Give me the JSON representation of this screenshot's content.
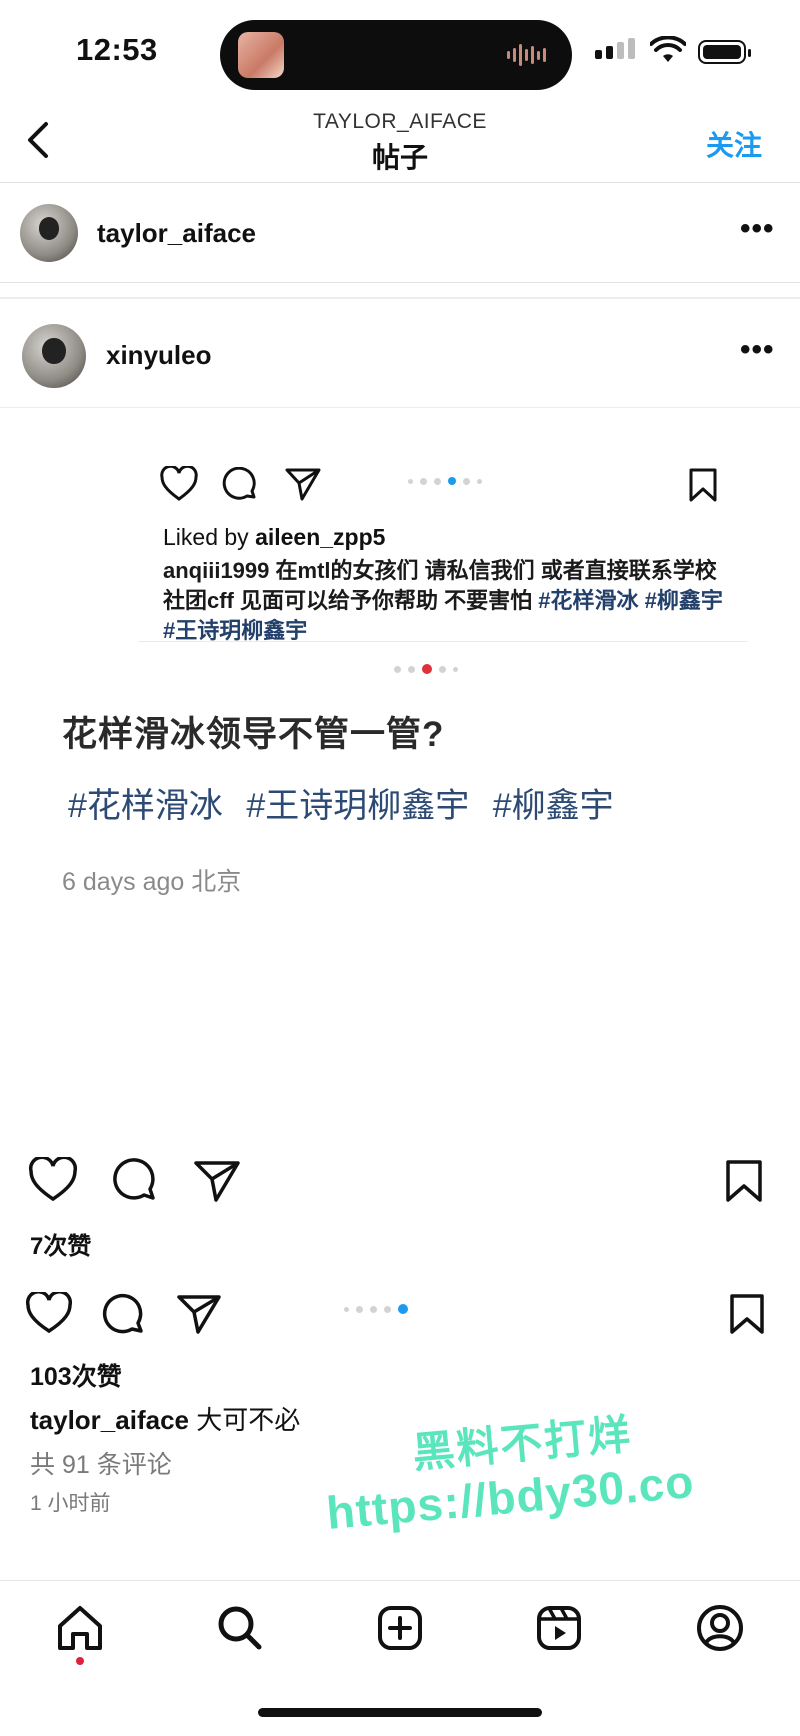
{
  "status_bar": {
    "time": "12:53"
  },
  "nav": {
    "subtitle": "TAYLOR_AIFACE",
    "title": "帖子",
    "follow_label": "关注"
  },
  "post_header": {
    "username": "taylor_aiface"
  },
  "embedded_post": {
    "username": "xinyuleo",
    "liked_by_prefix": "Liked by ",
    "liked_by_user": "aileen_zpp5",
    "caption_user": "anqiii1999",
    "caption_text": " 在mtl的女孩们 请私信我们 或者直接联系学校社团cff 见面可以给予你帮助 不要害怕 ",
    "caption_tags": "#花样滑冰 #柳鑫宇 #王诗玥柳鑫宇",
    "question": "花样滑冰领导不管一管?",
    "tags": [
      "#花样滑冰",
      "#王诗玥柳鑫宇",
      "#柳鑫宇"
    ],
    "meta": "6 days ago 北京",
    "likes": "7次赞"
  },
  "main_post": {
    "likes": "103次赞",
    "caption_user": "taylor_aiface",
    "caption_text": " 大可不必",
    "comments": "共 91 条评论",
    "time_ago": "1 小时前"
  },
  "watermark": {
    "line1": "黑料不打烊",
    "line2": "https://bdy30.co",
    "color": "#4ee3b8"
  },
  "colors": {
    "accent": "#1a9af0",
    "tag": "#2c4a73",
    "notification_dot": "#e0203a"
  },
  "tabbar": {
    "items": [
      "home-icon",
      "search-icon",
      "new-post-icon",
      "reels-icon",
      "profile-icon"
    ]
  }
}
